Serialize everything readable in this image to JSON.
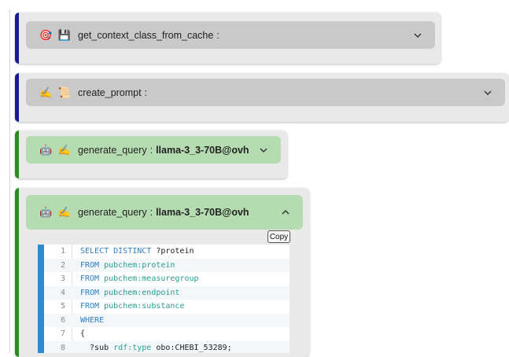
{
  "colors": {
    "accent_blue": "#1a1a8c",
    "accent_green": "#2e8b24",
    "header_gray": "#c9c9c9",
    "header_green": "#b5dcb0",
    "code_bar": "#2f8bd0"
  },
  "cards": [
    {
      "icons": "🎯 💾",
      "name": "get_context_class_from_cache",
      "sep": ":",
      "model": "",
      "chevron": "chevron-down",
      "accent": "blue"
    },
    {
      "icons": "✍️ 📜",
      "name": "create_prompt",
      "sep": ":",
      "model": "",
      "chevron": "chevron-down",
      "accent": "blue"
    },
    {
      "icons": "🤖 ✍️",
      "name": "generate_query",
      "sep": ":",
      "model": "llama-3_3-70B@ovh",
      "chevron": "chevron-down",
      "accent": "green"
    },
    {
      "icons": "🤖 ✍️",
      "name": "generate_query",
      "sep": ":",
      "model": "llama-3_3-70B@ovh",
      "chevron": "chevron-up",
      "accent": "green"
    }
  ],
  "copy_label": "Copy",
  "code_lines": [
    {
      "n": "1",
      "parts": [
        [
          "kw",
          "SELECT DISTINCT "
        ],
        [
          "tx",
          "?protein"
        ]
      ]
    },
    {
      "n": "2",
      "parts": [
        [
          "kw",
          "FROM "
        ],
        [
          "nm",
          "pubchem:protein"
        ]
      ]
    },
    {
      "n": "3",
      "parts": [
        [
          "kw",
          "FROM "
        ],
        [
          "nm",
          "pubchem:measuregroup"
        ]
      ]
    },
    {
      "n": "4",
      "parts": [
        [
          "kw",
          "FROM "
        ],
        [
          "nm",
          "pubchem:endpoint"
        ]
      ]
    },
    {
      "n": "5",
      "parts": [
        [
          "kw",
          "FROM "
        ],
        [
          "nm",
          "pubchem:substance"
        ]
      ]
    },
    {
      "n": "6",
      "parts": [
        [
          "kw",
          "WHERE"
        ]
      ]
    },
    {
      "n": "7",
      "parts": [
        [
          "tx",
          "{"
        ]
      ]
    },
    {
      "n": "8",
      "parts": [
        [
          "tx",
          "  ?sub "
        ],
        [
          "nm",
          "rdf:type "
        ],
        [
          "tx",
          "obo:CHEBI_53289;"
        ]
      ]
    }
  ]
}
